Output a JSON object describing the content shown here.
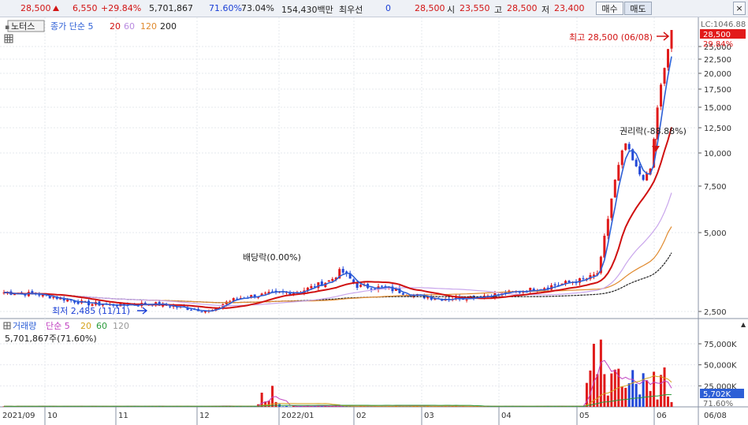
{
  "quote": {
    "price": "28,500",
    "change": "6,550",
    "change_pct": "+29.84%",
    "volume": "5,701,867",
    "turnover_pct": "71.60%",
    "ratio_pct": "73.04%",
    "amount": "154,430백만",
    "bid_label": "최우선",
    "bid_qty": "0",
    "ask_price": "28,500",
    "open_label": "시",
    "open": "23,550",
    "high_label": "고",
    "high": "28,500",
    "low_label": "저",
    "low": "23,400",
    "buy_label": "매수",
    "sell_label": "매도",
    "close_icon": "close-icon"
  },
  "price_panel": {
    "mode_button": "노터스",
    "legend_prefix": "종가 단순 5",
    "ma_periods": [
      "20",
      "60",
      "120",
      "200"
    ],
    "ma_colors": [
      "#d01010",
      "#b98ae0",
      "#e08a2e",
      "#222222"
    ],
    "short_ma_color": "#2d5fd6",
    "lc_label": "LC:1046.88",
    "last_price_tag": "28,500",
    "last_pct_tag": "29.84%",
    "annotations": {
      "high": "최고 28,500 (06/08)",
      "low": "최저 2,485 (11/11)",
      "dividend": "배당락(0.00%)",
      "rights": "권리락(-88.88%)"
    },
    "y_ticks": [
      "25,000",
      "22,500",
      "20,000",
      "17,500",
      "15,000",
      "12,500",
      "10,000",
      "7,500",
      "5,000",
      "2,500"
    ]
  },
  "volume_panel": {
    "legend_prefix": "거래량",
    "legend_ma": "단순 5",
    "ma_periods": [
      "20",
      "60",
      "120"
    ],
    "ma_colors": [
      "#d4a21a",
      "#2a9a3a",
      "#999999"
    ],
    "legend_value": "5,701,867주(71.60%)",
    "y_ticks": [
      "75,000K",
      "50,000K",
      "25,000K"
    ],
    "last_volume_tag": "5,702K",
    "last_pct_tag": "71.60%"
  },
  "x_axis": [
    "2021/09",
    "10",
    "11",
    "12",
    "2022/01",
    "02",
    "03",
    "04",
    "05",
    "06",
    "06/08"
  ]
}
